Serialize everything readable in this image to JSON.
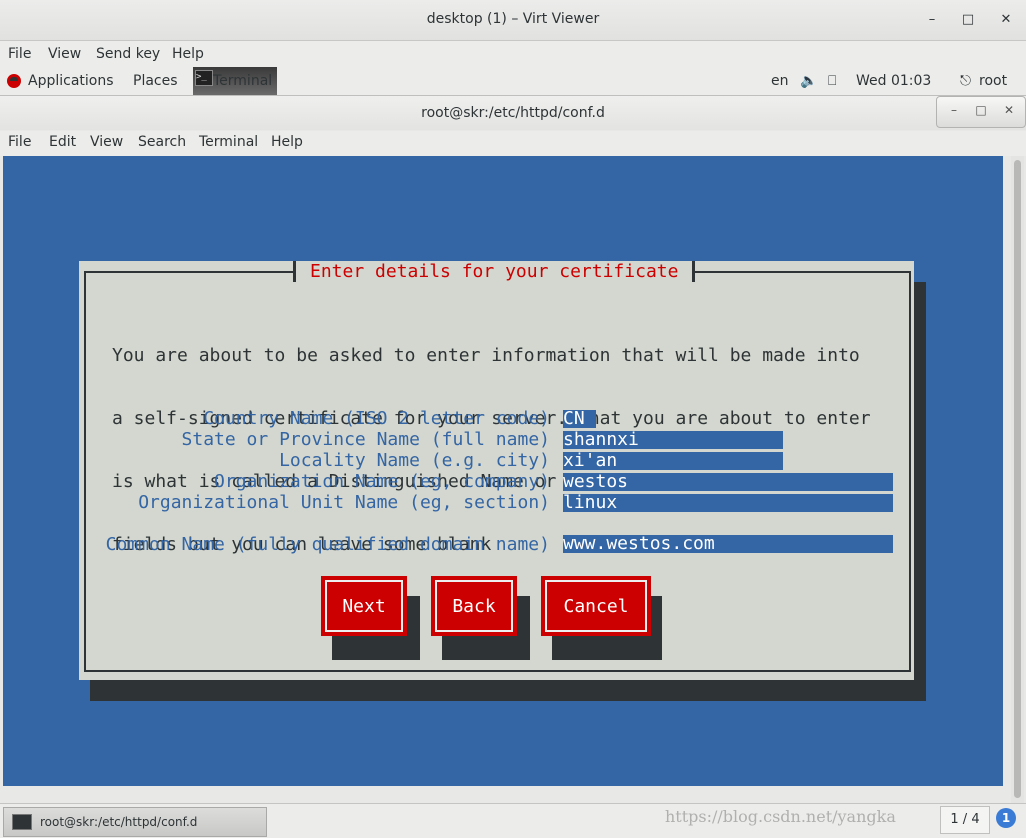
{
  "viewer": {
    "title": "desktop (1) – Virt Viewer",
    "menu": [
      "File",
      "View",
      "Send key",
      "Help"
    ]
  },
  "panel": {
    "applications": "Applications",
    "places": "Places",
    "terminal_task": "Terminal",
    "lang": "en",
    "clock": "Wed 01:03",
    "user": "root"
  },
  "terminal": {
    "title": "root@skr:/etc/httpd/conf.d",
    "menu": [
      "File",
      "Edit",
      "View",
      "Search",
      "Terminal",
      "Help"
    ]
  },
  "dialog": {
    "title": "Enter details for your certificate",
    "paragraph": [
      "You are about to be asked to enter information that will be made into",
      "a self-signed certificate for your server. What you are about to enter",
      "is what is called a Distinguished Name or a DN.  There are quite a few",
      "fields but you can leave some blank"
    ],
    "fields": [
      {
        "label": "Country Name (ISO 2 letter code)",
        "value": "CN"
      },
      {
        "label": "State or Province Name (full name)",
        "value": "shannxi"
      },
      {
        "label": "Locality Name (e.g. city)",
        "value": "xi'an"
      },
      {
        "label": "Organization Name (eg, company)",
        "value": "westos"
      },
      {
        "label": "Organizational Unit Name (eg, section)",
        "value": "linux"
      },
      {
        "label": "Common Name (fully qualified domain name)",
        "value": "www.westos.com"
      }
    ],
    "buttons": {
      "next": "Next",
      "back": "Back",
      "cancel": "Cancel"
    }
  },
  "taskbar": {
    "item": "root@skr:/etc/httpd/conf.d",
    "pager": "1 / 4",
    "watermark": "https://blog.csdn.net/yangka"
  },
  "colors": {
    "terminal_bg": "#3465a4",
    "dialog_bg": "#d3d7cf",
    "accent_red": "#cc0000",
    "shadow": "#2e3436"
  }
}
